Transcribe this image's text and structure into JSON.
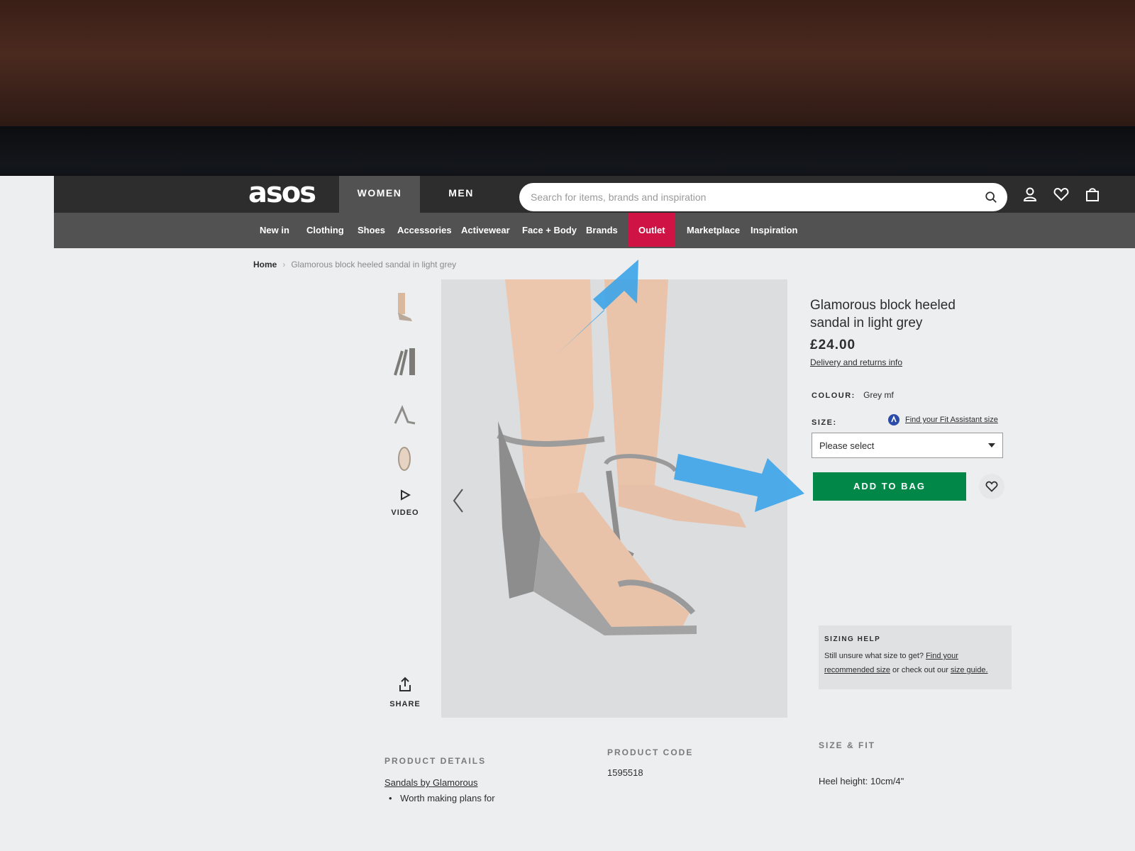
{
  "header": {
    "logo": "asos",
    "gender_tabs": [
      "WOMEN",
      "MEN"
    ],
    "search": {
      "placeholder": "Search for items, brands and inspiration",
      "value": ""
    },
    "icons": [
      "search-icon",
      "account-icon",
      "heart-icon",
      "bag-icon"
    ]
  },
  "nav": {
    "items": [
      "New in",
      "Clothing",
      "Shoes",
      "Accessories",
      "Activewear",
      "Face + Body",
      "Brands",
      "Outlet",
      "Marketplace",
      "Inspiration"
    ],
    "highlight_color": "#d01345"
  },
  "breadcrumb": {
    "home": "Home",
    "current": "Glamorous block heeled sandal in light grey"
  },
  "gallery": {
    "video_label": "VIDEO",
    "share_label": "SHARE",
    "thumb_count": 4
  },
  "product": {
    "title": "Glamorous block heeled sandal in light grey",
    "price": "£24.00",
    "delivery_link": "Delivery and returns info",
    "colour_label": "COLOUR:",
    "colour_value": "Grey mf",
    "size_label": "SIZE:",
    "fit_assistant": "Find your Fit Assistant size",
    "size_select": "Please select",
    "add_to_bag": "ADD TO BAG",
    "accent_color": "#018849"
  },
  "sizing_help": {
    "heading": "SIZING HELP",
    "text_1": "Still unsure what size to get? ",
    "link_1": "Find your recommended size",
    "text_2": " or check out our ",
    "link_2": "size guide."
  },
  "details": {
    "product_details_h": "PRODUCT DETAILS",
    "sandals_by": "Sandals by ",
    "brand": "Glamorous",
    "bullet": "Worth making plans for",
    "product_code_h": "PRODUCT CODE",
    "product_code": "1595518",
    "size_fit_h": "SIZE & FIT",
    "heel_height": "Heel height: 10cm/4\""
  }
}
